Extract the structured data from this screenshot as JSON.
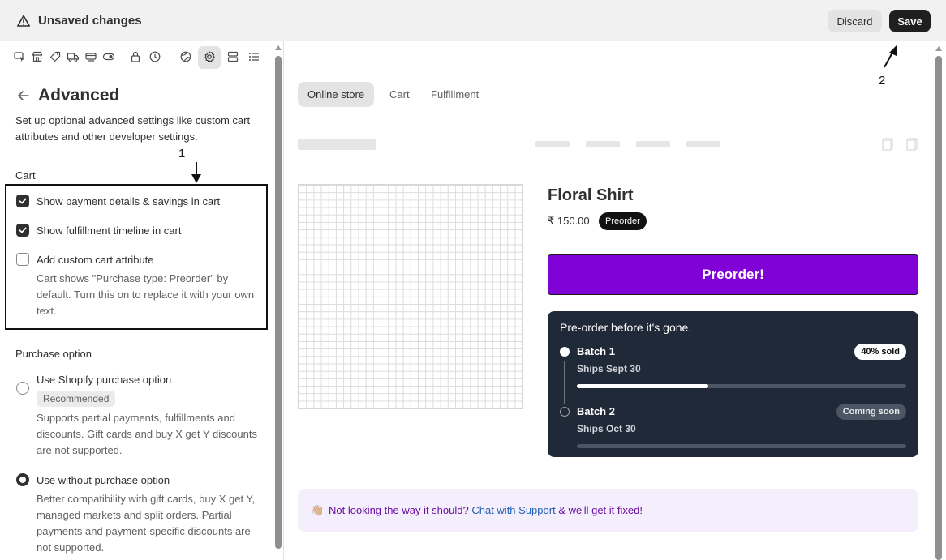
{
  "topbar": {
    "title": "Unsaved changes",
    "discard_label": "Discard",
    "save_label": "Save"
  },
  "toolbar": {
    "icons": [
      "cursor-rectangle-icon",
      "store-icon",
      "tag-icon",
      "truck-icon",
      "payment-icon",
      "toggle-icon",
      "lock-icon",
      "clock-icon",
      "globe-icon",
      "gear-icon",
      "layout-icon",
      "list-icon"
    ],
    "active_icon": "gear-icon"
  },
  "panel": {
    "title": "Advanced",
    "description": "Set up optional advanced settings like custom cart attributes and other developer settings."
  },
  "annotations": {
    "label_1": "1",
    "label_2": "2"
  },
  "cart": {
    "section_label": "Cart",
    "options": [
      {
        "label": "Show payment details & savings in cart",
        "checked": true
      },
      {
        "label": "Show fulfillment timeline in cart",
        "checked": true
      },
      {
        "label": "Add custom cart attribute",
        "checked": false
      }
    ],
    "custom_attr_help": "Cart shows \"Purchase type: Preorder\" by default. Turn this on to replace it with your own text."
  },
  "purchase": {
    "section_label": "Purchase option",
    "options": [
      {
        "label": "Use Shopify purchase option",
        "badge": "Recommended",
        "help": "Supports partial payments, fulfillments and discounts. Gift cards and buy X get Y discounts are not supported.",
        "selected": false
      },
      {
        "label": "Use without purchase option",
        "help": "Better compatibility with gift cards, buy X get Y, managed markets and split orders. Partial payments and payment-specific discounts are not supported.",
        "selected": true
      }
    ]
  },
  "preview": {
    "tabs": [
      "Online store",
      "Cart",
      "Fulfillment"
    ],
    "active_tab": "Online store",
    "product": {
      "title": "Floral Shirt",
      "price": "₹ 150.00",
      "badge": "Preorder",
      "button_label": "Preorder!",
      "button_color": "#8102d6"
    },
    "batches": {
      "title": "Pre-order before it's gone.",
      "items": [
        {
          "name": "Batch 1",
          "ships": "Ships Sept 30",
          "status": "40% sold",
          "progress": 0.4
        },
        {
          "name": "Batch 2",
          "ships": "Ships Oct 30",
          "status": "Coming soon",
          "progress": 0
        }
      ]
    },
    "support": {
      "emoji": "👋🏼",
      "text_before": "Not looking the way it should?",
      "link": "Chat with Support",
      "text_after": "& we'll get it fixed!"
    }
  }
}
